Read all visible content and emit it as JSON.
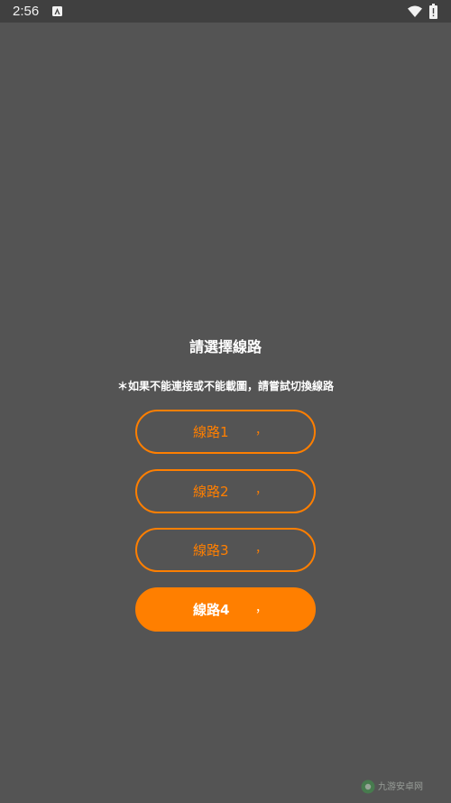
{
  "status_bar": {
    "time": "2:56",
    "notification_icon": "app-notification-icon",
    "wifi_icon": "wifi-icon",
    "battery_icon": "battery-icon"
  },
  "dialog": {
    "title": "請選擇線路",
    "hint": "＊如果不能連接或不能載圖，請嘗試切換線路",
    "buttons": [
      {
        "label": "線路1",
        "mark": "，",
        "selected": false
      },
      {
        "label": "線路2",
        "mark": "，",
        "selected": false
      },
      {
        "label": "線路3",
        "mark": "，",
        "selected": false
      },
      {
        "label": "線路4",
        "mark": "，",
        "selected": true
      }
    ]
  },
  "colors": {
    "background": "#545454",
    "status_bar": "#404040",
    "accent": "#ff7f00",
    "text": "#ffffff"
  },
  "watermark": {
    "text": "九游安卓网"
  }
}
